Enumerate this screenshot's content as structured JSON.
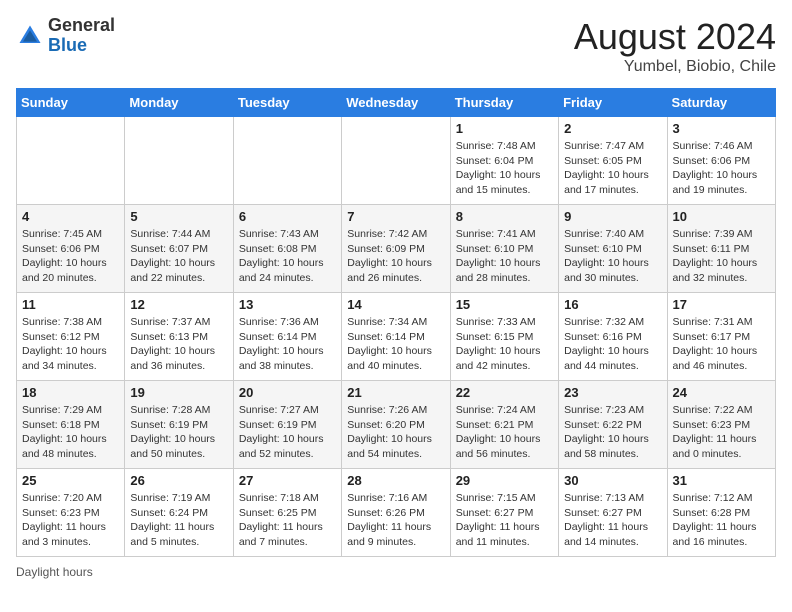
{
  "header": {
    "logo_general": "General",
    "logo_blue": "Blue",
    "month_year": "August 2024",
    "location": "Yumbel, Biobio, Chile"
  },
  "days_of_week": [
    "Sunday",
    "Monday",
    "Tuesday",
    "Wednesday",
    "Thursday",
    "Friday",
    "Saturday"
  ],
  "weeks": [
    [
      {
        "day": "",
        "info": ""
      },
      {
        "day": "",
        "info": ""
      },
      {
        "day": "",
        "info": ""
      },
      {
        "day": "",
        "info": ""
      },
      {
        "day": "1",
        "info": "Sunrise: 7:48 AM\nSunset: 6:04 PM\nDaylight: 10 hours and 15 minutes."
      },
      {
        "day": "2",
        "info": "Sunrise: 7:47 AM\nSunset: 6:05 PM\nDaylight: 10 hours and 17 minutes."
      },
      {
        "day": "3",
        "info": "Sunrise: 7:46 AM\nSunset: 6:06 PM\nDaylight: 10 hours and 19 minutes."
      }
    ],
    [
      {
        "day": "4",
        "info": "Sunrise: 7:45 AM\nSunset: 6:06 PM\nDaylight: 10 hours and 20 minutes."
      },
      {
        "day": "5",
        "info": "Sunrise: 7:44 AM\nSunset: 6:07 PM\nDaylight: 10 hours and 22 minutes."
      },
      {
        "day": "6",
        "info": "Sunrise: 7:43 AM\nSunset: 6:08 PM\nDaylight: 10 hours and 24 minutes."
      },
      {
        "day": "7",
        "info": "Sunrise: 7:42 AM\nSunset: 6:09 PM\nDaylight: 10 hours and 26 minutes."
      },
      {
        "day": "8",
        "info": "Sunrise: 7:41 AM\nSunset: 6:10 PM\nDaylight: 10 hours and 28 minutes."
      },
      {
        "day": "9",
        "info": "Sunrise: 7:40 AM\nSunset: 6:10 PM\nDaylight: 10 hours and 30 minutes."
      },
      {
        "day": "10",
        "info": "Sunrise: 7:39 AM\nSunset: 6:11 PM\nDaylight: 10 hours and 32 minutes."
      }
    ],
    [
      {
        "day": "11",
        "info": "Sunrise: 7:38 AM\nSunset: 6:12 PM\nDaylight: 10 hours and 34 minutes."
      },
      {
        "day": "12",
        "info": "Sunrise: 7:37 AM\nSunset: 6:13 PM\nDaylight: 10 hours and 36 minutes."
      },
      {
        "day": "13",
        "info": "Sunrise: 7:36 AM\nSunset: 6:14 PM\nDaylight: 10 hours and 38 minutes."
      },
      {
        "day": "14",
        "info": "Sunrise: 7:34 AM\nSunset: 6:14 PM\nDaylight: 10 hours and 40 minutes."
      },
      {
        "day": "15",
        "info": "Sunrise: 7:33 AM\nSunset: 6:15 PM\nDaylight: 10 hours and 42 minutes."
      },
      {
        "day": "16",
        "info": "Sunrise: 7:32 AM\nSunset: 6:16 PM\nDaylight: 10 hours and 44 minutes."
      },
      {
        "day": "17",
        "info": "Sunrise: 7:31 AM\nSunset: 6:17 PM\nDaylight: 10 hours and 46 minutes."
      }
    ],
    [
      {
        "day": "18",
        "info": "Sunrise: 7:29 AM\nSunset: 6:18 PM\nDaylight: 10 hours and 48 minutes."
      },
      {
        "day": "19",
        "info": "Sunrise: 7:28 AM\nSunset: 6:19 PM\nDaylight: 10 hours and 50 minutes."
      },
      {
        "day": "20",
        "info": "Sunrise: 7:27 AM\nSunset: 6:19 PM\nDaylight: 10 hours and 52 minutes."
      },
      {
        "day": "21",
        "info": "Sunrise: 7:26 AM\nSunset: 6:20 PM\nDaylight: 10 hours and 54 minutes."
      },
      {
        "day": "22",
        "info": "Sunrise: 7:24 AM\nSunset: 6:21 PM\nDaylight: 10 hours and 56 minutes."
      },
      {
        "day": "23",
        "info": "Sunrise: 7:23 AM\nSunset: 6:22 PM\nDaylight: 10 hours and 58 minutes."
      },
      {
        "day": "24",
        "info": "Sunrise: 7:22 AM\nSunset: 6:23 PM\nDaylight: 11 hours and 0 minutes."
      }
    ],
    [
      {
        "day": "25",
        "info": "Sunrise: 7:20 AM\nSunset: 6:23 PM\nDaylight: 11 hours and 3 minutes."
      },
      {
        "day": "26",
        "info": "Sunrise: 7:19 AM\nSunset: 6:24 PM\nDaylight: 11 hours and 5 minutes."
      },
      {
        "day": "27",
        "info": "Sunrise: 7:18 AM\nSunset: 6:25 PM\nDaylight: 11 hours and 7 minutes."
      },
      {
        "day": "28",
        "info": "Sunrise: 7:16 AM\nSunset: 6:26 PM\nDaylight: 11 hours and 9 minutes."
      },
      {
        "day": "29",
        "info": "Sunrise: 7:15 AM\nSunset: 6:27 PM\nDaylight: 11 hours and 11 minutes."
      },
      {
        "day": "30",
        "info": "Sunrise: 7:13 AM\nSunset: 6:27 PM\nDaylight: 11 hours and 14 minutes."
      },
      {
        "day": "31",
        "info": "Sunrise: 7:12 AM\nSunset: 6:28 PM\nDaylight: 11 hours and 16 minutes."
      }
    ]
  ],
  "footer": {
    "daylight_label": "Daylight hours"
  }
}
